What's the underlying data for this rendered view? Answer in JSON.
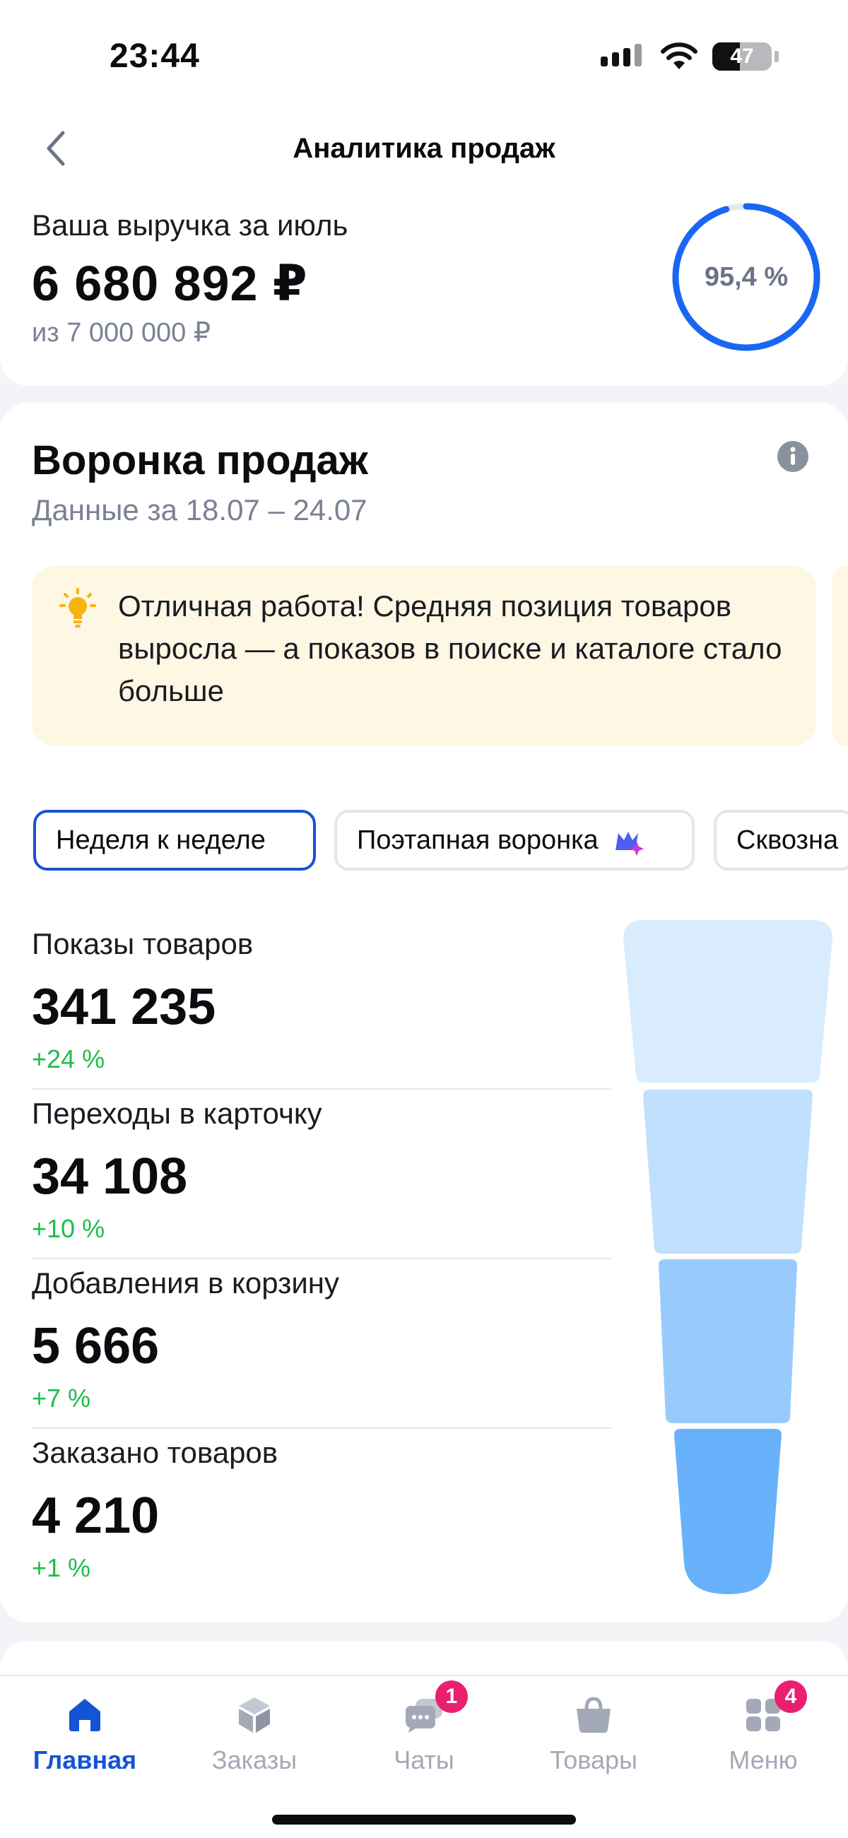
{
  "status": {
    "time": "23:44",
    "battery": "47",
    "battery_level": 0.47
  },
  "header": {
    "title": "Аналитика продаж",
    "revenue_label": "Ваша выручка за июль",
    "revenue_value": "6 680 892 ₽",
    "revenue_target": "из 7 000 000 ₽",
    "progress_text": "95,4 %",
    "progress_fraction": 0.954
  },
  "funnel": {
    "title": "Воронка продаж",
    "period": "Данные за 18.07 – 24.07",
    "tip": "Отличная работа! Средняя позиция товаров выросла — а показов в поиске и каталоге стало больше",
    "chips": [
      "Неделя к неделе",
      "Поэтапная воронка",
      "Сквозна"
    ],
    "metrics": [
      {
        "label": "Показы товаров",
        "value": "341 235",
        "delta": "+24 %"
      },
      {
        "label": "Переходы в карточку",
        "value": "34 108",
        "delta": "+10 %"
      },
      {
        "label": "Добавления в корзину",
        "value": "5 666",
        "delta": "+7 %"
      },
      {
        "label": "Заказано товаров",
        "value": "4 210",
        "delta": "+1 %"
      }
    ]
  },
  "colors": {
    "accent": "#1553d6",
    "positive": "#1ebd4a",
    "badge": "#ea1f6f",
    "funnel": [
      "#d8ecfd",
      "#c0e0fd",
      "#98cbfc",
      "#68b2fb"
    ]
  },
  "tabbar": {
    "tabs": [
      {
        "label": "Главная",
        "icon": "home-icon"
      },
      {
        "label": "Заказы",
        "icon": "box-icon"
      },
      {
        "label": "Чаты",
        "icon": "chat-icon",
        "badge": "1"
      },
      {
        "label": "Товары",
        "icon": "bag-icon"
      },
      {
        "label": "Меню",
        "icon": "menu-icon",
        "badge": "4"
      }
    ]
  }
}
